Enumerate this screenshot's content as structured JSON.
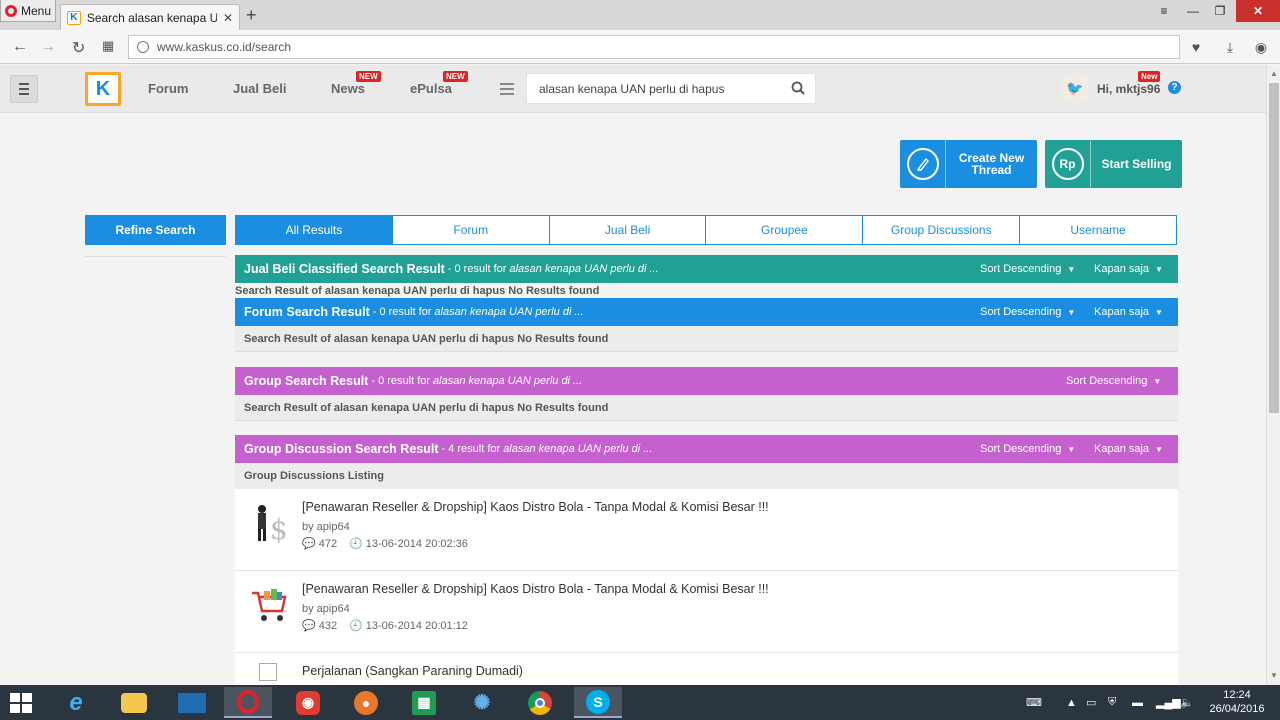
{
  "browser": {
    "menu_label": "Menu",
    "tab_title": "Search alasan kenapa UAN",
    "tab_favicon": "K",
    "new_tab": "+",
    "url": "www.kaskus.co.id/search"
  },
  "header": {
    "nav": [
      {
        "label": "Forum"
      },
      {
        "label": "Jual Beli"
      },
      {
        "label": "News",
        "badge": "NEW"
      },
      {
        "label": "ePulsa",
        "badge": "NEW"
      }
    ],
    "search_value": "alasan kenapa UAN perlu di hapus",
    "user_greeting": "Hi, mktjs96",
    "user_badge": "New",
    "help": "?"
  },
  "actions": {
    "create_thread": "Create New Thread",
    "start_selling": "Start Selling",
    "sell_icon_text": "Rp"
  },
  "refine_label": "Refine Search",
  "tabs": [
    {
      "label": "All Results",
      "active": true
    },
    {
      "label": "Forum"
    },
    {
      "label": "Jual Beli"
    },
    {
      "label": "Groupee"
    },
    {
      "label": "Group Discussions"
    },
    {
      "label": "Username"
    }
  ],
  "sections": {
    "jualbeli": {
      "title": "Jual Beli Classified Search Result",
      "count": "- 0 result for",
      "query": "alasan kenapa UAN perlu di ...",
      "sort": "Sort Descending",
      "time": "Kapan saja",
      "message": "Search Result of alasan kenapa UAN perlu di hapus No Results found"
    },
    "forum": {
      "title": "Forum Search Result",
      "count": "- 0 result for",
      "query": "alasan kenapa UAN perlu di ...",
      "sort": "Sort Descending",
      "time": "Kapan saja",
      "message": "Search Result of alasan kenapa UAN perlu di hapus No Results found"
    },
    "group": {
      "title": "Group Search Result",
      "count": "- 0 result for",
      "query": "alasan kenapa UAN perlu di ...",
      "sort": "Sort Descending",
      "message": "Search Result of alasan kenapa UAN perlu di hapus No Results found"
    },
    "discussion": {
      "title": "Group Discussion Search Result",
      "count": "- 4 result for",
      "query": "alasan kenapa UAN perlu di ...",
      "sort": "Sort Descending",
      "time": "Kapan saja",
      "listing": "Group Discussions Listing",
      "items": [
        {
          "title": "[Penawaran Reseller & Dropship] Kaos Distro Bola - Tanpa Modal & Komisi Besar !!!",
          "author": "by apip64",
          "comments": "472",
          "date": "13-06-2014 20:02:36"
        },
        {
          "title": "[Penawaran Reseller & Dropship] Kaos Distro Bola - Tanpa Modal & Komisi Besar !!!",
          "author": "by apip64",
          "comments": "432",
          "date": "13-06-2014 20:01:12"
        },
        {
          "title": "Perjalanan (Sangkan Paraning Dumadi)"
        }
      ]
    }
  },
  "taskbar": {
    "time": "12:24",
    "date": "26/04/2016"
  },
  "colors": {
    "kaskus_blue": "#1a8ee0",
    "kaskus_green": "#21a196",
    "group_purple": "#c561cf",
    "logo_orange": "#f7a823"
  }
}
